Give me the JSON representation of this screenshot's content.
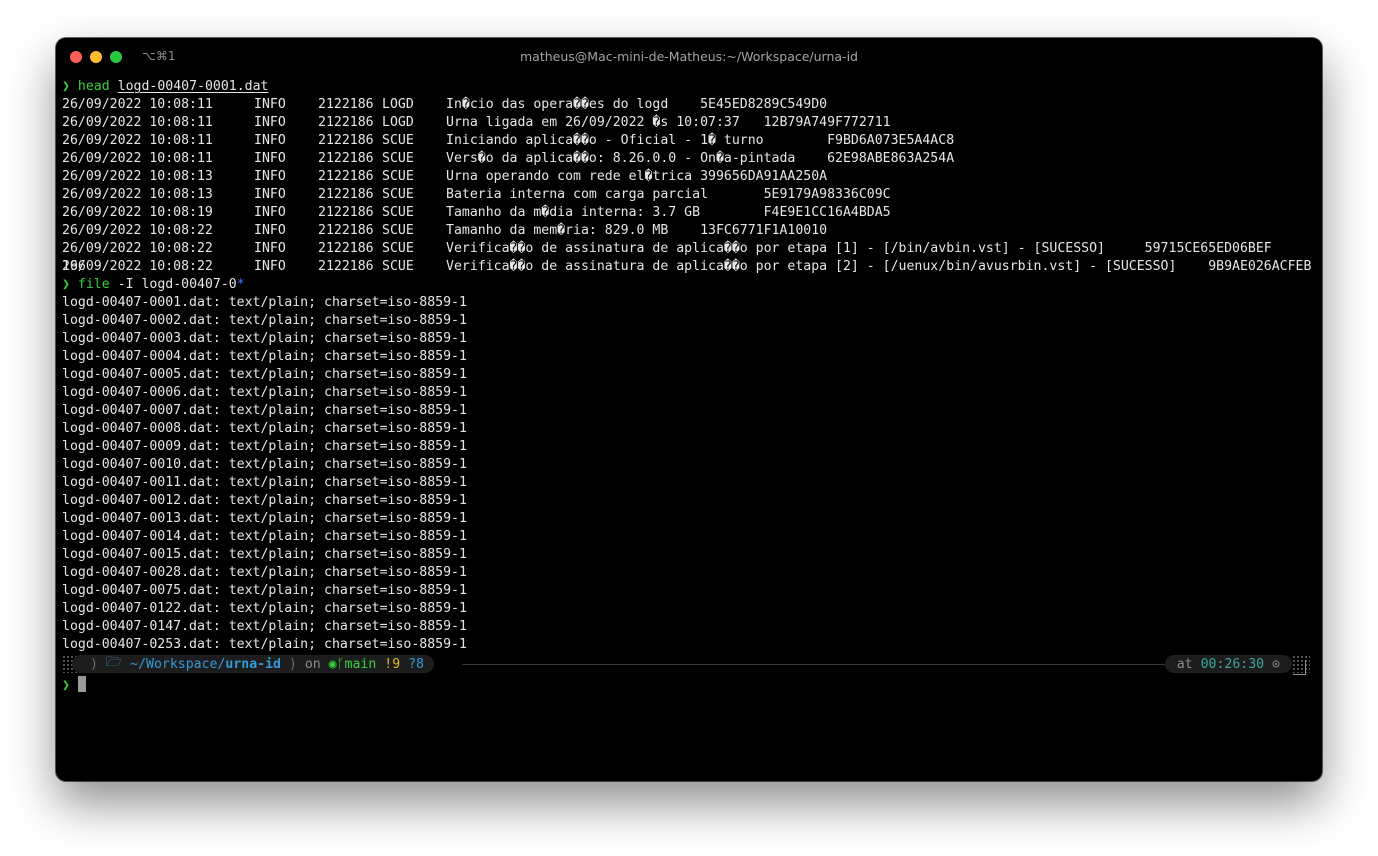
{
  "window": {
    "title": "matheus@Mac-mini-de-Matheus:~/Workspace/urna-id",
    "shortcut": "⌥⌘1"
  },
  "prompt_symbol": "❯",
  "command1": {
    "cmd": "head",
    "arg": "logd-00407-0001.dat"
  },
  "log_rows": [
    [
      "26/09/2022 10:08:11",
      "INFO",
      "2122186",
      "LOGD",
      "In�cio das opera��es do logd    5E45ED8289C549D0"
    ],
    [
      "26/09/2022 10:08:11",
      "INFO",
      "2122186",
      "LOGD",
      "Urna ligada em 26/09/2022 �s 10:07:37   12B79A749F772711"
    ],
    [
      "26/09/2022 10:08:11",
      "INFO",
      "2122186",
      "SCUE",
      "Iniciando aplica��o - Oficial - 1� turno        F9BD6A073E5A4AC8"
    ],
    [
      "26/09/2022 10:08:11",
      "INFO",
      "2122186",
      "SCUE",
      "Vers�o da aplica��o: 8.26.0.0 - On�a-pintada    62E98ABE863A254A"
    ],
    [
      "26/09/2022 10:08:13",
      "INFO",
      "2122186",
      "SCUE",
      "Urna operando com rede el�trica 399656DA91AA250A"
    ],
    [
      "26/09/2022 10:08:13",
      "INFO",
      "2122186",
      "SCUE",
      "Bateria interna com carga parcial       5E9179A98336C09C"
    ],
    [
      "26/09/2022 10:08:19",
      "INFO",
      "2122186",
      "SCUE",
      "Tamanho da m�dia interna: 3.7 GB        F4E9E1CC16A4BDA5"
    ],
    [
      "26/09/2022 10:08:22",
      "INFO",
      "2122186",
      "SCUE",
      "Tamanho da mem�ria: 829.0 MB    13FC6771F1A10010"
    ],
    [
      "26/09/2022 10:08:22",
      "INFO",
      "2122186",
      "SCUE",
      "Verifica��o de assinatura de aplica��o por etapa [1] - [/bin/avbin.vst] - [SUCESSO]     59715CE65ED06BEF"
    ],
    [
      "26/09/2022 10:08:22",
      "INFO",
      "2122186",
      "SCUE",
      "Verifica��o de assinatura de aplica��o por etapa [2] - [/uenux/bin/avusrbin.vst] - [SUCESSO]    9B9AE026ACFEB"
    ]
  ],
  "wrap_line": "196",
  "command2": {
    "cmd": "file",
    "arg": "-I logd-00407-0",
    "glob": "*"
  },
  "file_results": [
    "logd-00407-0001.dat: text/plain; charset=iso-8859-1",
    "logd-00407-0002.dat: text/plain; charset=iso-8859-1",
    "logd-00407-0003.dat: text/plain; charset=iso-8859-1",
    "logd-00407-0004.dat: text/plain; charset=iso-8859-1",
    "logd-00407-0005.dat: text/plain; charset=iso-8859-1",
    "logd-00407-0006.dat: text/plain; charset=iso-8859-1",
    "logd-00407-0007.dat: text/plain; charset=iso-8859-1",
    "logd-00407-0008.dat: text/plain; charset=iso-8859-1",
    "logd-00407-0009.dat: text/plain; charset=iso-8859-1",
    "logd-00407-0010.dat: text/plain; charset=iso-8859-1",
    "logd-00407-0011.dat: text/plain; charset=iso-8859-1",
    "logd-00407-0012.dat: text/plain; charset=iso-8859-1",
    "logd-00407-0013.dat: text/plain; charset=iso-8859-1",
    "logd-00407-0014.dat: text/plain; charset=iso-8859-1",
    "logd-00407-0015.dat: text/plain; charset=iso-8859-1",
    "logd-00407-0028.dat: text/plain; charset=iso-8859-1",
    "logd-00407-0075.dat: text/plain; charset=iso-8859-1",
    "logd-00407-0122.dat: text/plain; charset=iso-8859-1",
    "logd-00407-0147.dat: text/plain; charset=iso-8859-1",
    "logd-00407-0253.dat: text/plain; charset=iso-8859-1"
  ],
  "prompt_bar": {
    "os_icon": "apple-icon",
    "path_prefix": "~/Workspace/",
    "path_current": "urna-id",
    "on_label": "on",
    "branch": "main",
    "modified": "!9",
    "untracked": "?8",
    "at_label": "at",
    "time": "00:26:30",
    "clock_glyph": "⊙"
  },
  "colors": {
    "background": "#000000",
    "prompt_green": "#37d23b",
    "path_blue": "#2f9bd8",
    "dirty_yellow": "#e3b72b",
    "time_teal": "#37a7a0"
  }
}
